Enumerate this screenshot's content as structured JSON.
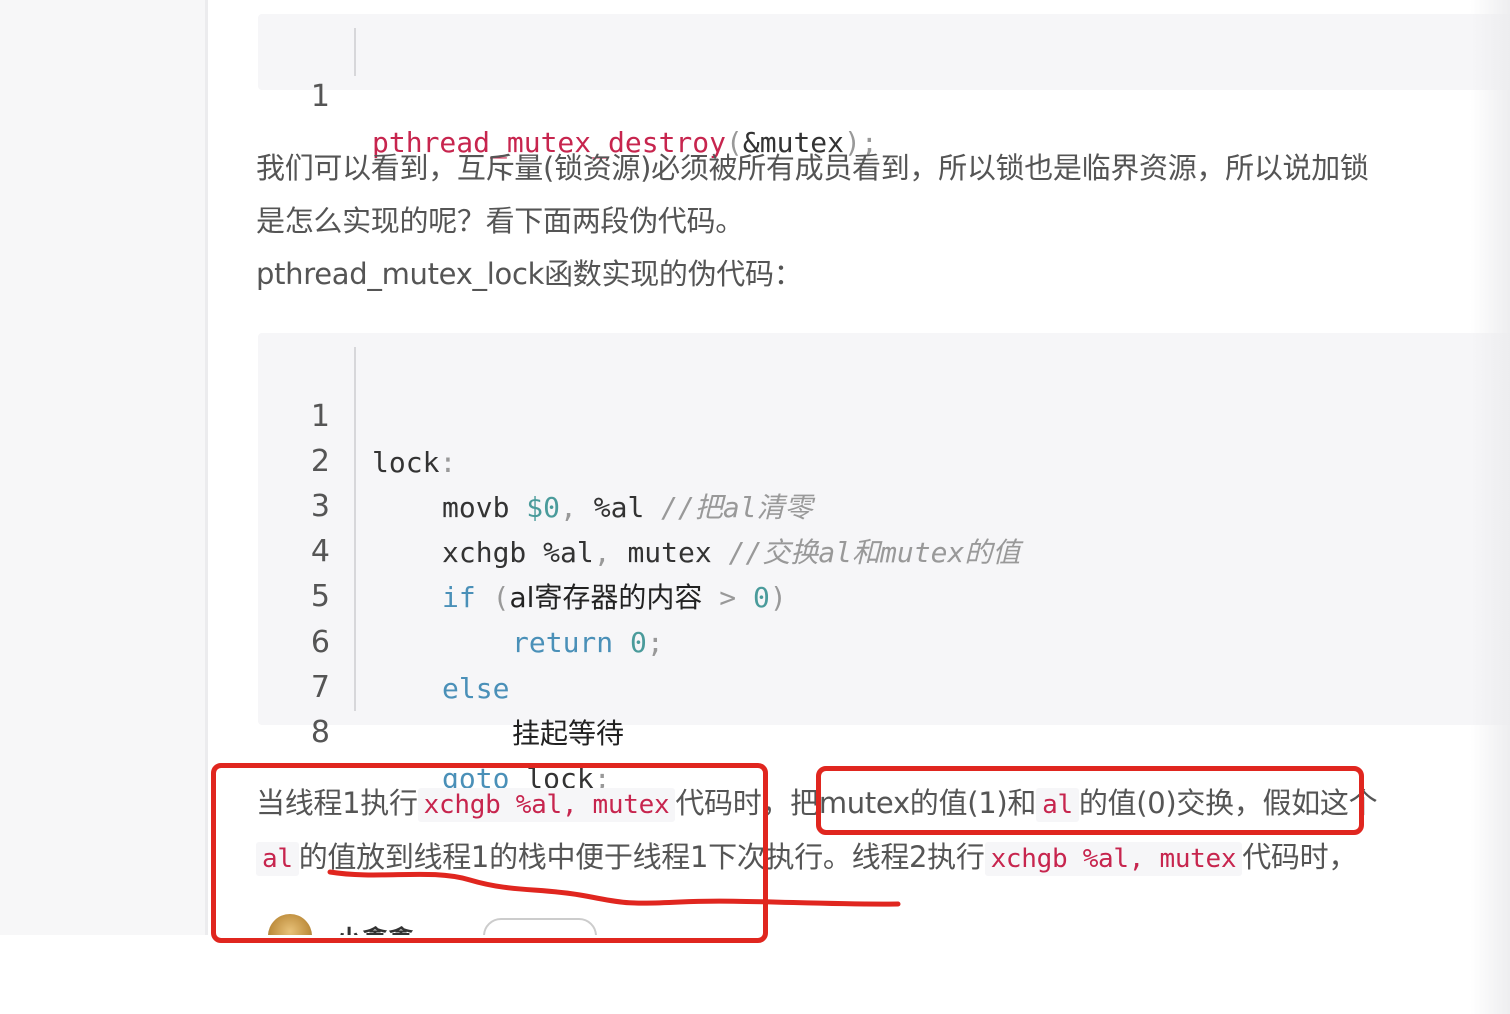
{
  "code_block_1": {
    "lines": [
      {
        "num": "1",
        "fn": "pthread_mutex_destroy",
        "open": "(",
        "arg": "&mutex",
        "close": ");"
      }
    ]
  },
  "paragraph_1": {
    "line1": "我们可以看到，互斥量(锁资源)必须被所有成员看到，所以锁也是临界资源，所以说加锁",
    "line2": "是怎么实现的呢？看下面两段伪代码。",
    "line3": "pthread_mutex_lock函数实现的伪代码："
  },
  "code_block_2": {
    "line_numbers": [
      "1",
      "2",
      "3",
      "4",
      "5",
      "6",
      "7",
      "8"
    ],
    "l1": {
      "label": "lock",
      "colon": ":"
    },
    "l2": {
      "op": "movb ",
      "imm": "$0",
      "comma": ", ",
      "reg": "%al ",
      "comment": "//把al清零"
    },
    "l3": {
      "op": "xchgb ",
      "reg": "%al",
      "comma": ", ",
      "arg": "mutex ",
      "comment": "//交换al和mutex的值"
    },
    "l4": {
      "kw": "if",
      "open": " (",
      "cond": "al寄存器的内容",
      "gt": " > ",
      "zero": "0",
      "close": ")"
    },
    "l5": {
      "kw": "return",
      "sp": " ",
      "zero": "0",
      "semi": ";"
    },
    "l6": {
      "kw": "else"
    },
    "l7": {
      "text": "挂起等待"
    },
    "l8": {
      "kw": "goto",
      "sp": " ",
      "label": "lock",
      "semi": ";"
    }
  },
  "paragraph_2": {
    "l1_a": "当线程1执行",
    "l1_code": "xchgb %al, mutex",
    "l1_b": "代码时，把mutex的值(1)和",
    "l1_code2": "al",
    "l1_c": "的值(0)交换，假如这个",
    "l2_code": "al",
    "l2_a": "的值放到线程1的栈中便于线程1下次执行。线程2执行",
    "l2_code2": "xchgb %al, mutex",
    "l2_b": "代码时，"
  },
  "author": {
    "name": "小鑫鑫"
  },
  "colors": {
    "annotation": "#e0261f",
    "inline_code": "#c7254e",
    "keyword": "#4a90b8"
  }
}
